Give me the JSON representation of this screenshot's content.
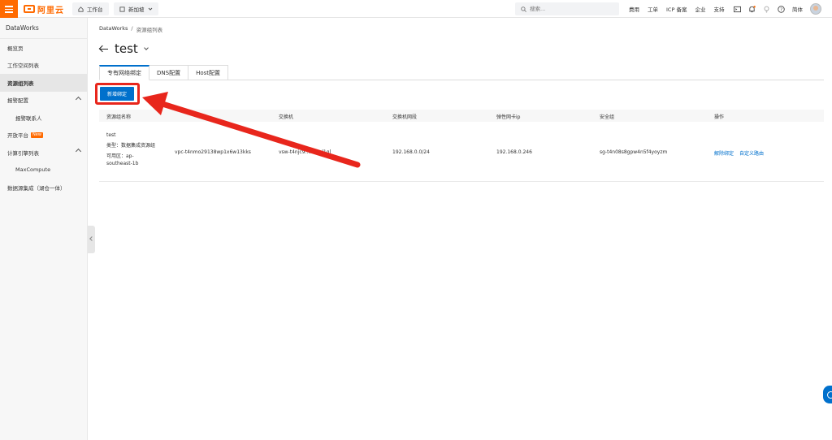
{
  "topbar": {
    "brand": "阿里云",
    "workbench": "工作台",
    "region": "新加坡",
    "search_placeholder": "搜索...",
    "links": [
      "费用",
      "工单",
      "ICP 备案",
      "企业",
      "支持"
    ],
    "lang": "简体"
  },
  "sidebar": {
    "title": "DataWorks",
    "items": [
      {
        "label": "概览页"
      },
      {
        "label": "工作空间列表"
      },
      {
        "label": "资源组列表"
      },
      {
        "label": "报警配置"
      },
      {
        "label": "报警联系人"
      },
      {
        "label": "开放平台"
      },
      {
        "label": "计算引擎列表"
      },
      {
        "label": "MaxCompute"
      },
      {
        "label": "数据源集成（湖仓一体）"
      }
    ],
    "new_badge": "New"
  },
  "breadcrumb": {
    "root": "DataWorks",
    "sep": "/",
    "current": "资源组列表"
  },
  "page_title": "test",
  "tabs": [
    "专有网络绑定",
    "DNS配置",
    "Host配置"
  ],
  "add_button": "新增绑定",
  "table": {
    "headers": [
      "资源组名称",
      "交换机",
      "交换机网段",
      "弹性网卡ip",
      "安全组",
      "操作"
    ],
    "row": {
      "name": "test",
      "type": "类型：数据集成资源组",
      "zone": "可用区：ap-",
      "zone2": "southeast-1b",
      "vpc": "vpc-t4nmo29138wp1x6w13kks",
      "vswitch": "vsw-t4njc9...l7aml1gl",
      "cidr": "192.168.0.0/24",
      "eni_ip": "192.168.0.246",
      "sg": "sg-t4n08s8gpw4n5f4yoyzm",
      "action_unbind": "解除绑定",
      "action_route": "自定义路由"
    }
  },
  "colors": {
    "brand": "#ff6a00",
    "primary": "#0070cc",
    "annotation": "#e8261c"
  }
}
